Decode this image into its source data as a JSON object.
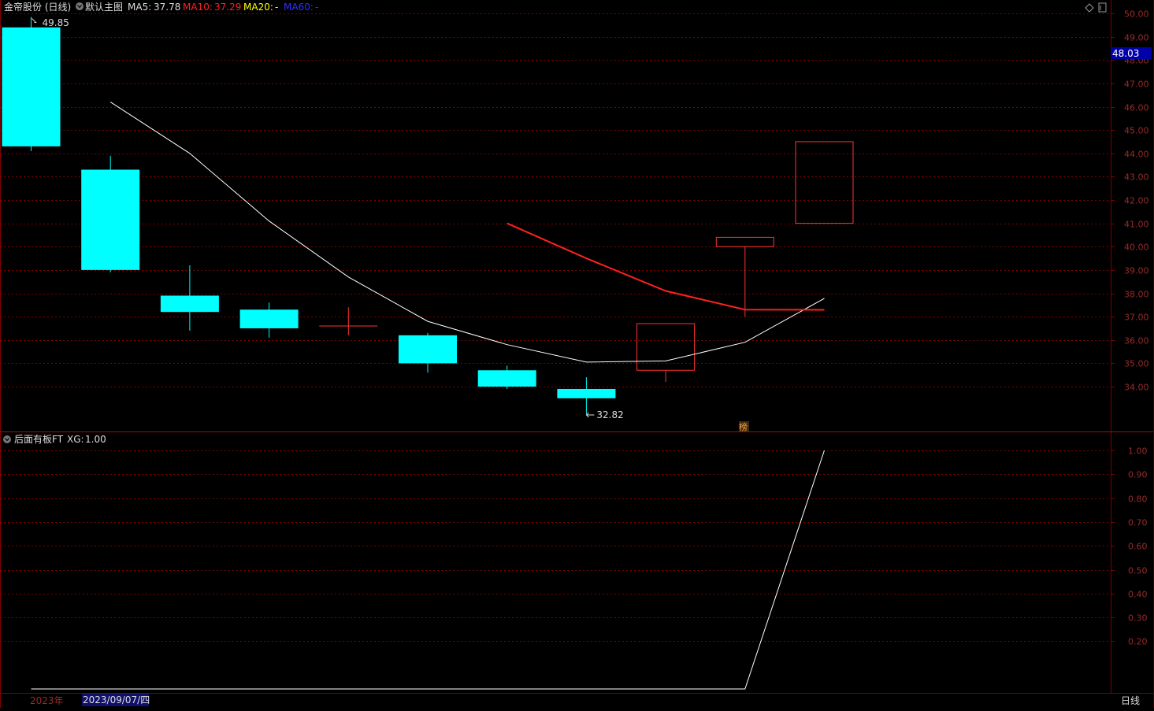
{
  "header": {
    "stock_name": "金帝股份 (日线)",
    "template": "默认主图",
    "ma5_label": "MA5:",
    "ma5_value": "37.78",
    "ma10_label": "MA10:",
    "ma10_value": "37.29",
    "ma20_label": "MA20:",
    "ma20_value": "-",
    "ma60_label": "MA60:",
    "ma60_value": "-"
  },
  "indicator": {
    "name": "后面有板FT",
    "xg_label": "XG:",
    "xg_value": "1.00"
  },
  "current_price_tag": "48.03",
  "annotations": {
    "high": "49.85",
    "low": "32.82",
    "marker": "榜"
  },
  "bottom_bar": {
    "year": "2023年",
    "date": "2023/09/07/四",
    "period": "日线"
  },
  "colors": {
    "up": "#ff3232",
    "down": "#00ffff",
    "ma5": "#ffffff",
    "ma10": "#ff2020",
    "ma20": "#ffff00",
    "ma60": "#3030ff",
    "grid": "#800000",
    "axis_text": "#9a2a2a",
    "price_tag_bg": "#0000a8"
  },
  "chart_data": [
    {
      "type": "candlestick",
      "title": "金帝股份 (日线)",
      "y_ticks": [
        "34.00",
        "35.00",
        "36.00",
        "37.00",
        "38.00",
        "39.00",
        "40.00",
        "41.00",
        "42.00",
        "43.00",
        "44.00",
        "45.00",
        "46.00",
        "47.00",
        "48.00",
        "49.00",
        "50.00"
      ],
      "ylim": [
        32.0,
        50.0
      ],
      "candles": [
        {
          "open": 49.4,
          "high": 49.85,
          "low": 44.1,
          "close": 44.3
        },
        {
          "open": 43.3,
          "high": 43.9,
          "low": 38.9,
          "close": 39.0
        },
        {
          "open": 37.9,
          "high": 39.2,
          "low": 36.4,
          "close": 37.2
        },
        {
          "open": 37.3,
          "high": 37.6,
          "low": 36.1,
          "close": 36.5
        },
        {
          "open": 36.6,
          "high": 37.4,
          "low": 36.2,
          "close": 36.6
        },
        {
          "open": 36.2,
          "high": 36.3,
          "low": 34.6,
          "close": 35.0
        },
        {
          "open": 34.7,
          "high": 34.9,
          "low": 33.9,
          "close": 34.0
        },
        {
          "open": 33.9,
          "high": 34.4,
          "low": 32.82,
          "close": 33.5
        },
        {
          "open": 34.7,
          "high": 36.7,
          "low": 34.2,
          "close": 36.7
        },
        {
          "open": 40.0,
          "high": 40.4,
          "low": 37.0,
          "close": 40.4
        },
        {
          "open": 41.0,
          "high": 44.5,
          "low": 41.0,
          "close": 44.5
        }
      ],
      "ma5": [
        null,
        46.2,
        44.0,
        41.1,
        38.7,
        36.8,
        35.8,
        35.05,
        35.1,
        35.9,
        37.78
      ],
      "ma10": [
        null,
        null,
        null,
        null,
        null,
        null,
        41.0,
        39.5,
        38.1,
        37.3,
        37.29
      ]
    },
    {
      "type": "line",
      "title": "后面有板FT",
      "series": [
        {
          "name": "XG",
          "values": [
            0,
            0,
            0,
            0,
            0,
            0,
            0,
            0,
            0,
            0,
            1.0
          ]
        }
      ],
      "y_ticks": [
        "0.20",
        "0.30",
        "0.40",
        "0.50",
        "0.60",
        "0.70",
        "0.80",
        "0.90",
        "1.00"
      ],
      "ylim": [
        0.0,
        1.0
      ]
    }
  ]
}
